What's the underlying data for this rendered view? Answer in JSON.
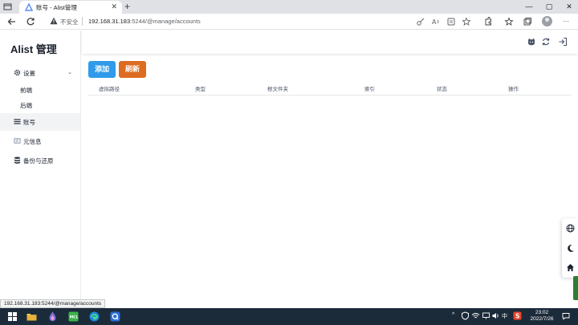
{
  "browser": {
    "tab_title": "账号 - Alist管理",
    "new_tab": "+",
    "tab_close": "✕",
    "controls": {
      "minimize": "—",
      "maximize": "▢",
      "close": "✕"
    },
    "security_text": "不安全",
    "url_host": "192.168.31.183",
    "url_rest": ":5244/@manage/accounts",
    "status_url": "192.168.31.183:5244/@manage/accounts",
    "more": "···"
  },
  "sidebar": {
    "brand": "Alist 管理",
    "settings_label": "设置",
    "settings_chevron": "⌄",
    "sub_frontend": "前端",
    "sub_backend": "后端",
    "accounts_label": "账号",
    "meta_label": "元信息",
    "backup_label": "备份与还原"
  },
  "main": {
    "add_button": "添加",
    "refresh_button": "刷新",
    "columns": [
      "虚拟路径",
      "类型",
      "根文件夹",
      "索引",
      "状态",
      "操作"
    ]
  },
  "taskbar": {
    "time": "23:02",
    "date": "2022/7/26",
    "tray_ime": "中",
    "tray_chevron": "^"
  },
  "colors": {
    "add": "#2f9bea",
    "refresh": "#dd6b20",
    "taskbar": "#1c2b3a"
  }
}
